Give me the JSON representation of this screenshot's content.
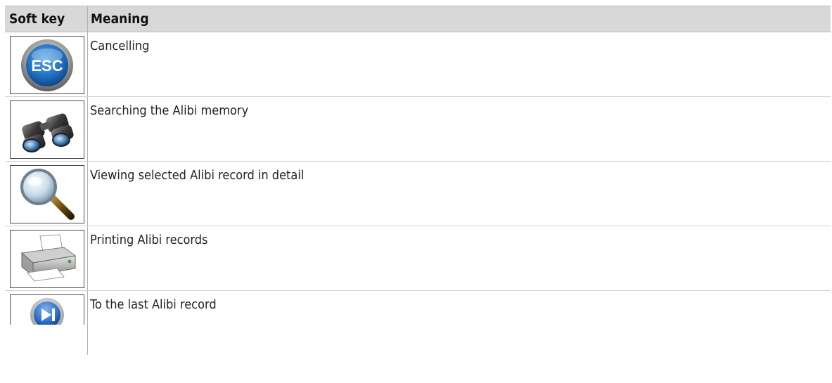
{
  "table": {
    "headers": {
      "soft_key": "Soft key",
      "meaning": "Meaning"
    },
    "rows": [
      {
        "icon": "esc-icon",
        "meaning": "Cancelling"
      },
      {
        "icon": "binoculars-icon",
        "meaning": "Searching the Alibi memory"
      },
      {
        "icon": "magnifier-icon",
        "meaning": "Viewing selected Alibi record in detail"
      },
      {
        "icon": "printer-icon",
        "meaning": "Printing Alibi records"
      },
      {
        "icon": "skip-to-end-icon",
        "meaning": "To the last Alibi record"
      }
    ]
  },
  "icons": {
    "esc_label": "ESC"
  },
  "colors": {
    "header_bg": "#d8d8d8",
    "esc_blue": "#1f6fc0",
    "playback_blue": "#2a6bc4"
  }
}
